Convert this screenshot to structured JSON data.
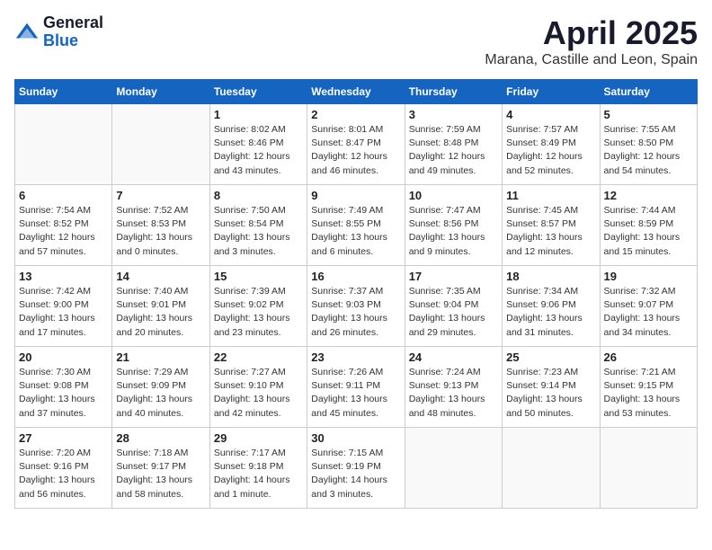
{
  "logo": {
    "general": "General",
    "blue": "Blue"
  },
  "title": "April 2025",
  "location": "Marana, Castille and Leon, Spain",
  "weekdays": [
    "Sunday",
    "Monday",
    "Tuesday",
    "Wednesday",
    "Thursday",
    "Friday",
    "Saturday"
  ],
  "weeks": [
    [
      {
        "day": "",
        "info": ""
      },
      {
        "day": "",
        "info": ""
      },
      {
        "day": "1",
        "info": "Sunrise: 8:02 AM\nSunset: 8:46 PM\nDaylight: 12 hours and 43 minutes."
      },
      {
        "day": "2",
        "info": "Sunrise: 8:01 AM\nSunset: 8:47 PM\nDaylight: 12 hours and 46 minutes."
      },
      {
        "day": "3",
        "info": "Sunrise: 7:59 AM\nSunset: 8:48 PM\nDaylight: 12 hours and 49 minutes."
      },
      {
        "day": "4",
        "info": "Sunrise: 7:57 AM\nSunset: 8:49 PM\nDaylight: 12 hours and 52 minutes."
      },
      {
        "day": "5",
        "info": "Sunrise: 7:55 AM\nSunset: 8:50 PM\nDaylight: 12 hours and 54 minutes."
      }
    ],
    [
      {
        "day": "6",
        "info": "Sunrise: 7:54 AM\nSunset: 8:52 PM\nDaylight: 12 hours and 57 minutes."
      },
      {
        "day": "7",
        "info": "Sunrise: 7:52 AM\nSunset: 8:53 PM\nDaylight: 13 hours and 0 minutes."
      },
      {
        "day": "8",
        "info": "Sunrise: 7:50 AM\nSunset: 8:54 PM\nDaylight: 13 hours and 3 minutes."
      },
      {
        "day": "9",
        "info": "Sunrise: 7:49 AM\nSunset: 8:55 PM\nDaylight: 13 hours and 6 minutes."
      },
      {
        "day": "10",
        "info": "Sunrise: 7:47 AM\nSunset: 8:56 PM\nDaylight: 13 hours and 9 minutes."
      },
      {
        "day": "11",
        "info": "Sunrise: 7:45 AM\nSunset: 8:57 PM\nDaylight: 13 hours and 12 minutes."
      },
      {
        "day": "12",
        "info": "Sunrise: 7:44 AM\nSunset: 8:59 PM\nDaylight: 13 hours and 15 minutes."
      }
    ],
    [
      {
        "day": "13",
        "info": "Sunrise: 7:42 AM\nSunset: 9:00 PM\nDaylight: 13 hours and 17 minutes."
      },
      {
        "day": "14",
        "info": "Sunrise: 7:40 AM\nSunset: 9:01 PM\nDaylight: 13 hours and 20 minutes."
      },
      {
        "day": "15",
        "info": "Sunrise: 7:39 AM\nSunset: 9:02 PM\nDaylight: 13 hours and 23 minutes."
      },
      {
        "day": "16",
        "info": "Sunrise: 7:37 AM\nSunset: 9:03 PM\nDaylight: 13 hours and 26 minutes."
      },
      {
        "day": "17",
        "info": "Sunrise: 7:35 AM\nSunset: 9:04 PM\nDaylight: 13 hours and 29 minutes."
      },
      {
        "day": "18",
        "info": "Sunrise: 7:34 AM\nSunset: 9:06 PM\nDaylight: 13 hours and 31 minutes."
      },
      {
        "day": "19",
        "info": "Sunrise: 7:32 AM\nSunset: 9:07 PM\nDaylight: 13 hours and 34 minutes."
      }
    ],
    [
      {
        "day": "20",
        "info": "Sunrise: 7:30 AM\nSunset: 9:08 PM\nDaylight: 13 hours and 37 minutes."
      },
      {
        "day": "21",
        "info": "Sunrise: 7:29 AM\nSunset: 9:09 PM\nDaylight: 13 hours and 40 minutes."
      },
      {
        "day": "22",
        "info": "Sunrise: 7:27 AM\nSunset: 9:10 PM\nDaylight: 13 hours and 42 minutes."
      },
      {
        "day": "23",
        "info": "Sunrise: 7:26 AM\nSunset: 9:11 PM\nDaylight: 13 hours and 45 minutes."
      },
      {
        "day": "24",
        "info": "Sunrise: 7:24 AM\nSunset: 9:13 PM\nDaylight: 13 hours and 48 minutes."
      },
      {
        "day": "25",
        "info": "Sunrise: 7:23 AM\nSunset: 9:14 PM\nDaylight: 13 hours and 50 minutes."
      },
      {
        "day": "26",
        "info": "Sunrise: 7:21 AM\nSunset: 9:15 PM\nDaylight: 13 hours and 53 minutes."
      }
    ],
    [
      {
        "day": "27",
        "info": "Sunrise: 7:20 AM\nSunset: 9:16 PM\nDaylight: 13 hours and 56 minutes."
      },
      {
        "day": "28",
        "info": "Sunrise: 7:18 AM\nSunset: 9:17 PM\nDaylight: 13 hours and 58 minutes."
      },
      {
        "day": "29",
        "info": "Sunrise: 7:17 AM\nSunset: 9:18 PM\nDaylight: 14 hours and 1 minute."
      },
      {
        "day": "30",
        "info": "Sunrise: 7:15 AM\nSunset: 9:19 PM\nDaylight: 14 hours and 3 minutes."
      },
      {
        "day": "",
        "info": ""
      },
      {
        "day": "",
        "info": ""
      },
      {
        "day": "",
        "info": ""
      }
    ]
  ]
}
